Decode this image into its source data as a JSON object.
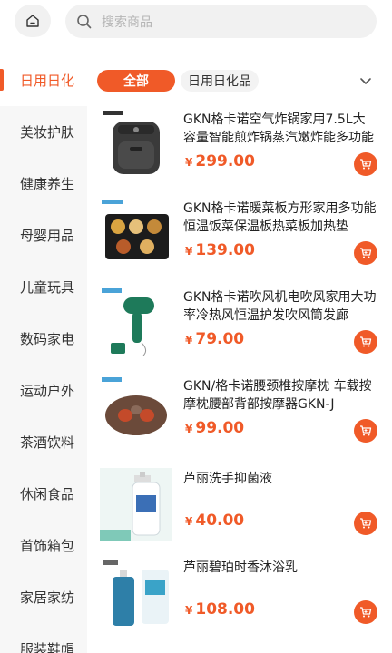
{
  "header": {
    "search_placeholder": "搜索商品"
  },
  "sidebar": {
    "items": [
      {
        "label": "日用日化",
        "active": true
      },
      {
        "label": "美妆护肤"
      },
      {
        "label": "健康养生"
      },
      {
        "label": "母婴用品"
      },
      {
        "label": "儿童玩具"
      },
      {
        "label": "数码家电"
      },
      {
        "label": "运动户外"
      },
      {
        "label": "茶酒饮料"
      },
      {
        "label": "休闲食品"
      },
      {
        "label": "首饰箱包"
      },
      {
        "label": "家居家纺"
      },
      {
        "label": "服装鞋帽"
      }
    ]
  },
  "tabs": {
    "all_label": "全部",
    "sub_label": "日用日化品"
  },
  "products": [
    {
      "title": "GKN格卡诺空气炸锅家用7.5L大容量智能煎炸锅蒸汽嫩炸能多功能",
      "symbol": "¥",
      "price": "299.00"
    },
    {
      "title": "GKN格卡诺暖菜板方形家用多功能恒温饭菜保温板热菜板加热垫",
      "symbol": "¥",
      "price": "139.00"
    },
    {
      "title": "GKN格卡诺吹风机电吹风家用大功率冷热风恒温护发吹风筒发廊",
      "symbol": "¥",
      "price": "79.00"
    },
    {
      "title": "GKN/格卡诺腰颈椎按摩枕 车载按摩枕腰部背部按摩器GKN-J",
      "symbol": "¥",
      "price": "99.00"
    },
    {
      "title": "芦丽洗手抑菌液",
      "symbol": "¥",
      "price": "40.00"
    },
    {
      "title": "芦丽碧珀时香沐浴乳",
      "symbol": "¥",
      "price": "108.00"
    }
  ],
  "colors": {
    "accent": "#f05a28"
  }
}
